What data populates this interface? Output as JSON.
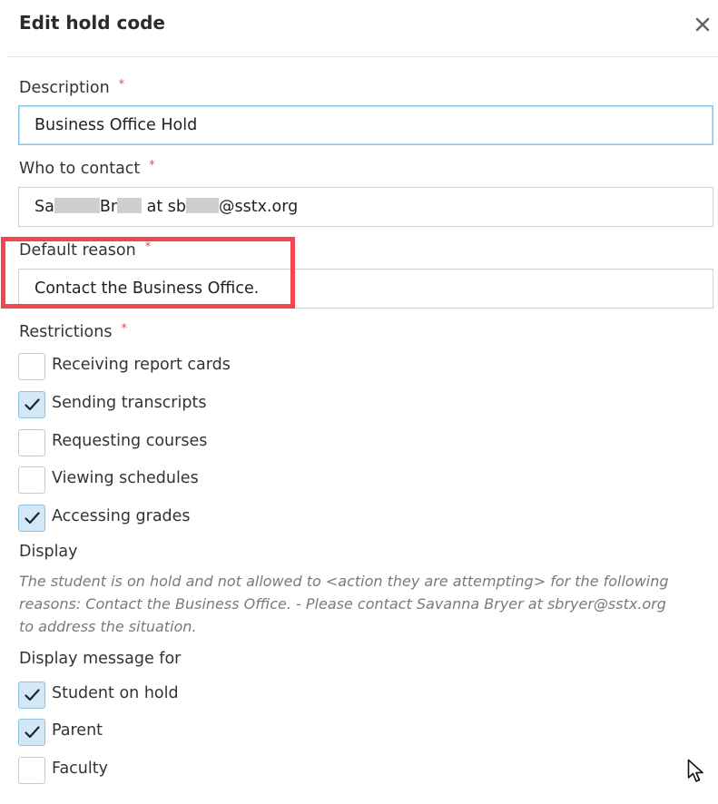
{
  "dialog": {
    "title": "Edit hold code",
    "close_label": "×"
  },
  "fields": {
    "required_mark": "*",
    "description": {
      "label": "Description",
      "value": "Business Office Hold"
    },
    "who_to_contact": {
      "label": "Who to contact",
      "value_parts": [
        "Sa",
        "Br",
        " at sb",
        "@sstx.org"
      ]
    },
    "default_reason": {
      "label": "Default reason",
      "value": "Contact the Business Office."
    }
  },
  "restrictions": {
    "label": "Restrictions",
    "items": [
      {
        "label": "Receiving report cards",
        "checked": false
      },
      {
        "label": "Sending transcripts",
        "checked": true
      },
      {
        "label": "Requesting courses",
        "checked": false
      },
      {
        "label": "Viewing schedules",
        "checked": false
      },
      {
        "label": "Accessing grades",
        "checked": true
      }
    ]
  },
  "display": {
    "label": "Display",
    "message": "The student is on hold and not allowed to <action they are attempting> for the following reasons: Contact the Business Office. - Please contact Savanna Bryer at sbryer@sstx.org to address the situation."
  },
  "display_message_for": {
    "label": "Display message for",
    "items": [
      {
        "label": "Student on hold",
        "checked": true
      },
      {
        "label": "Parent",
        "checked": true
      },
      {
        "label": "Faculty",
        "checked": false
      }
    ]
  },
  "colors": {
    "accent_border": "#86c4e8",
    "checkbox_checked_bg": "#d3e8f6",
    "highlight_box": "#f2464f",
    "required": "#d9534f"
  }
}
